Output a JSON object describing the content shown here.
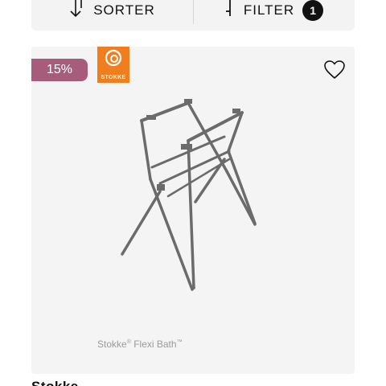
{
  "toolbar": {
    "sort_label": "SORTER",
    "filter_label": "FILTER",
    "filter_count": "1"
  },
  "card": {
    "discount": "15%",
    "brand_name": "STOKKE",
    "caption_brand": "Stokke",
    "caption_mark1": "®",
    "caption_product": "Flexi Bath",
    "caption_mark2": "™",
    "icons": [
      "heart-icon",
      "stokke-logo"
    ]
  },
  "product": {
    "title": "Stokke"
  },
  "colors": {
    "discount_badge": "#a85c7c",
    "brand_orange": "#f07e1e",
    "card_background": "#f4f4f4",
    "stand_frame": "#6b6b6b"
  }
}
